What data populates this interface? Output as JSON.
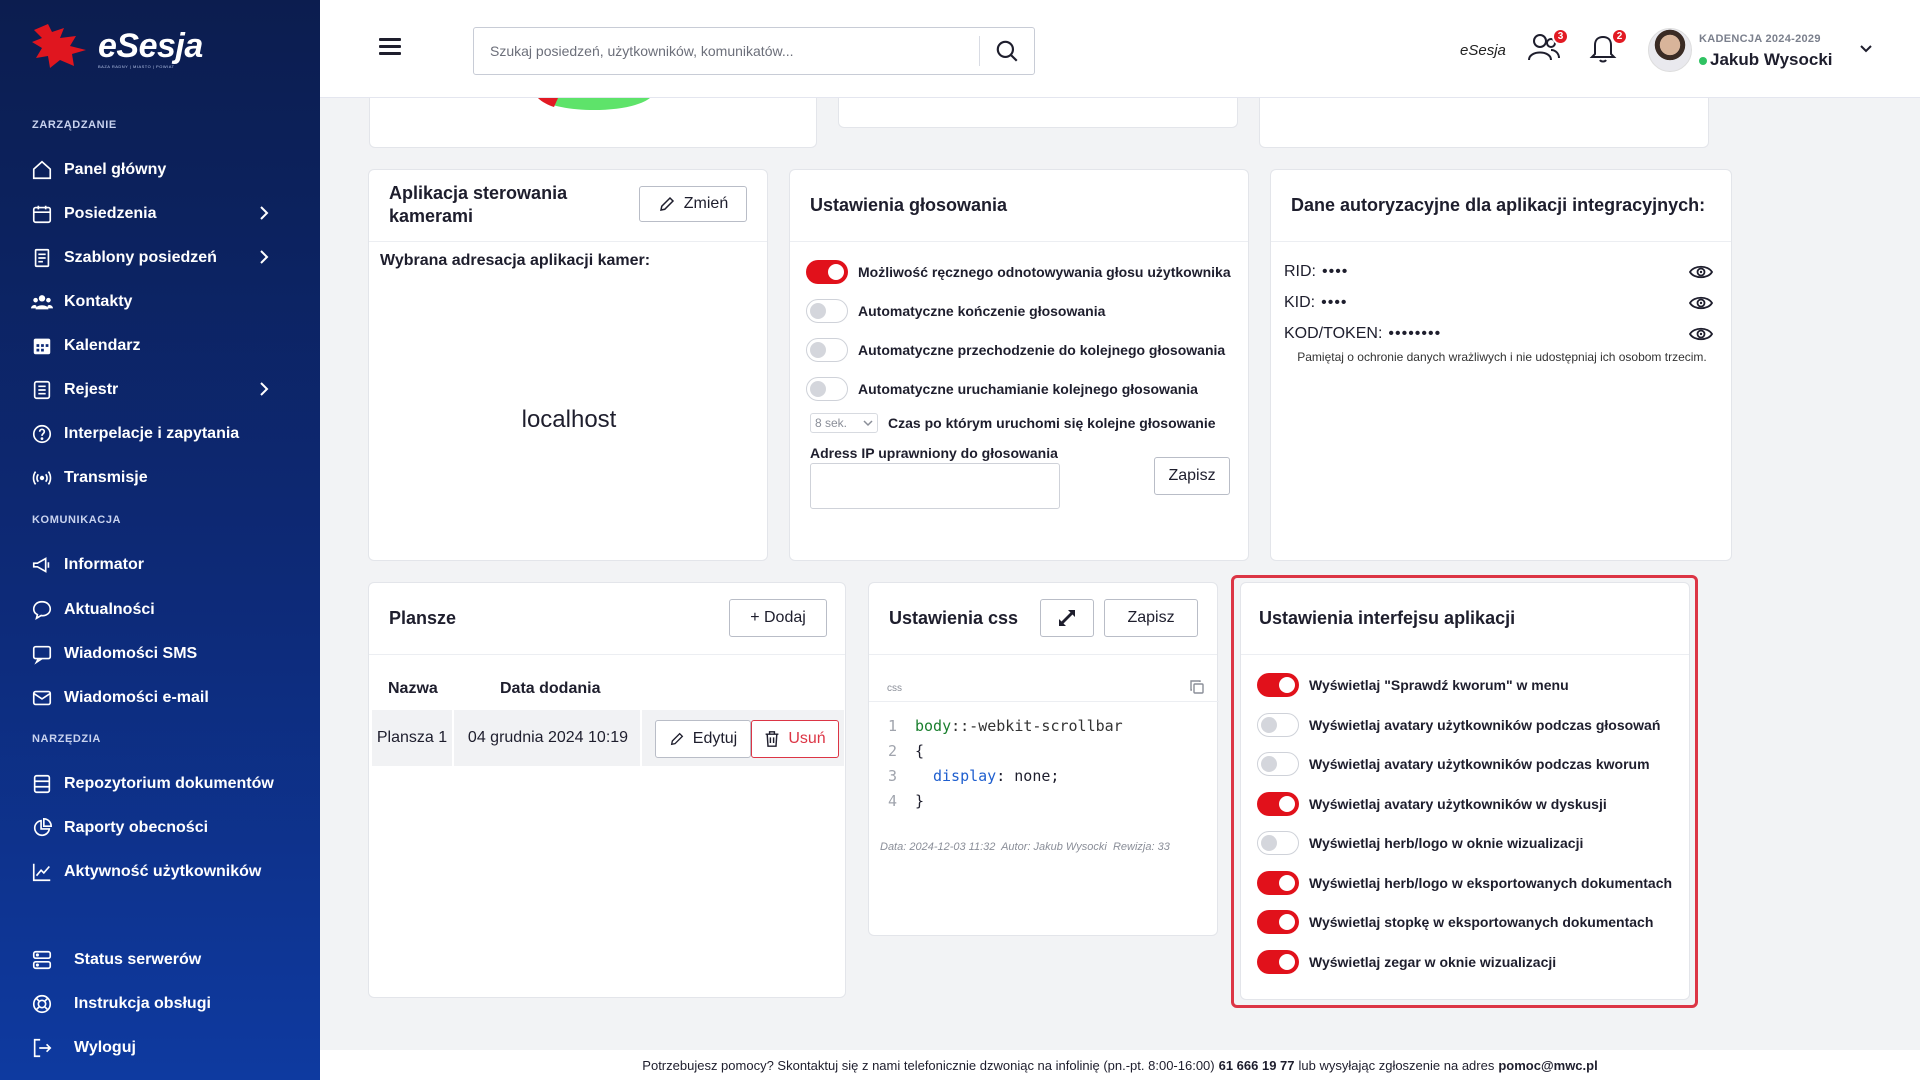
{
  "app": {
    "logo_text": "eSesja",
    "logo_sub": "BAZA RADNY | MIASTO | POWIAT"
  },
  "sidebar": {
    "section_management": "ZARZĄDZANIE",
    "section_communication": "KOMUNIKACJA",
    "section_tools": "NARZĘDZIA",
    "items": [
      {
        "label": "Panel główny",
        "icon": "home-icon"
      },
      {
        "label": "Posiedzenia",
        "icon": "calendar-icon"
      },
      {
        "label": "Szablony posiedzeń",
        "icon": "template-icon"
      },
      {
        "label": "Kontakty",
        "icon": "contacts-icon"
      },
      {
        "label": "Kalendarz",
        "icon": "calendar-grid-icon"
      },
      {
        "label": "Rejestr",
        "icon": "register-icon"
      },
      {
        "label": "Interpelacje i zapytania",
        "icon": "question-icon"
      },
      {
        "label": "Transmisje",
        "icon": "broadcast-icon"
      },
      {
        "label": "Informator",
        "icon": "megaphone-icon"
      },
      {
        "label": "Aktualności",
        "icon": "chat-icon"
      },
      {
        "label": "Wiadomości SMS",
        "icon": "sms-icon"
      },
      {
        "label": "Wiadomości e-mail",
        "icon": "mail-icon"
      },
      {
        "label": "Repozytorium dokumentów",
        "icon": "documents-icon"
      },
      {
        "label": "Raporty obecności",
        "icon": "pie-chart-icon"
      },
      {
        "label": "Aktywność użytkowników",
        "icon": "activity-icon"
      },
      {
        "label": "Status serwerów",
        "icon": "server-icon"
      },
      {
        "label": "Instrukcja obsługi",
        "icon": "lifebuoy-icon"
      },
      {
        "label": "Wyloguj",
        "icon": "logout-icon"
      }
    ]
  },
  "header": {
    "search_placeholder": "Szukaj posiedzeń, użytkowników, komunikatów...",
    "brand": "eSesja",
    "users_badge": "3",
    "bell_badge": "2",
    "user": {
      "term": "KADENCJA 2024-2029",
      "name": "Jakub Wysocki"
    }
  },
  "camera_card": {
    "title": "Aplikacja sterowania kamerami",
    "change_button": "Zmień",
    "subtitle": "Wybrana adresacja aplikacji kamer:",
    "address": "localhost"
  },
  "voting_card": {
    "title": "Ustawienia głosowania",
    "toggles": [
      {
        "label": "Możliwość ręcznego odnotowywania głosu użytkownika",
        "on": true
      },
      {
        "label": "Automatyczne kończenie głosowania",
        "on": false
      },
      {
        "label": "Automatyczne przechodzenie do kolejnego głosowania",
        "on": false
      },
      {
        "label": "Automatyczne uruchamianie kolejnego głosowania",
        "on": false
      }
    ],
    "delay_value": "8 sek.",
    "delay_label": "Czas po którym uruchomi się kolejne głosowanie",
    "ip_label": "Adress IP uprawniony do głosowania",
    "ip_value": "",
    "save_button": "Zapisz"
  },
  "auth_card": {
    "title": "Dane autoryzacyjne dla aplikacji integracyjnych:",
    "rows": [
      {
        "label": "RID:",
        "value": "••••"
      },
      {
        "label": "KID:",
        "value": "••••"
      },
      {
        "label": "KOD/TOKEN:",
        "value": "••••••••"
      }
    ],
    "note": "Pamiętaj o ochronie danych wrażliwych i nie udostępniaj ich osobom trzecim."
  },
  "boards_card": {
    "title": "Plansze",
    "add_button": "+ Dodaj",
    "columns": [
      "Nazwa",
      "Data dodania"
    ],
    "rows": [
      {
        "name": "Plansza 1",
        "date": "04 grudnia 2024 10:19",
        "edit": "Edytuj",
        "delete": "Usuń"
      }
    ]
  },
  "css_card": {
    "title": "Ustawienia css",
    "save_button": "Zapisz",
    "lang": "css",
    "code": [
      {
        "n": "1",
        "sel": "body",
        "rest": "::-webkit-scrollbar"
      },
      {
        "n": "2",
        "text": "{"
      },
      {
        "n": "3",
        "prop": "display",
        "val": ": none;"
      },
      {
        "n": "4",
        "text": "}"
      }
    ],
    "meta": "Data: 2024-12-03 11:32  Autor: Jakub Wysocki  Rewizja: 33"
  },
  "ui_card": {
    "title": "Ustawienia interfejsu aplikacji",
    "toggles": [
      {
        "label": "Wyświetlaj \"Sprawdź kworum\" w menu",
        "on": true
      },
      {
        "label": "Wyświetlaj avatary użytkowników podczas głosowań",
        "on": false
      },
      {
        "label": "Wyświetlaj avatary użytkowników podczas kworum",
        "on": false
      },
      {
        "label": "Wyświetlaj avatary użytkowników w dyskusji",
        "on": true
      },
      {
        "label": "Wyświetlaj herb/logo w oknie wizualizacji",
        "on": false
      },
      {
        "label": "Wyświetlaj herb/logo w eksportowanych dokumentach",
        "on": true
      },
      {
        "label": "Wyświetlaj stopkę w eksportowanych dokumentach",
        "on": true
      },
      {
        "label": "Wyświetlaj zegar w oknie wizualizacji",
        "on": true
      }
    ]
  },
  "footer": {
    "text": "Potrzebujesz pomocy? Skontaktuj się z nami telefonicznie dzwoniąc na infolinię (pn.-pt. 8:00-16:00)",
    "phone": "61 666 19 77",
    "middle": "lub wysyłając zgłoszenie na adres",
    "email": "pomoc@mwc.pl"
  },
  "colors": {
    "accent": "#e1111b",
    "sidebar": "#0d2a78",
    "highlight": "#dc3545"
  }
}
